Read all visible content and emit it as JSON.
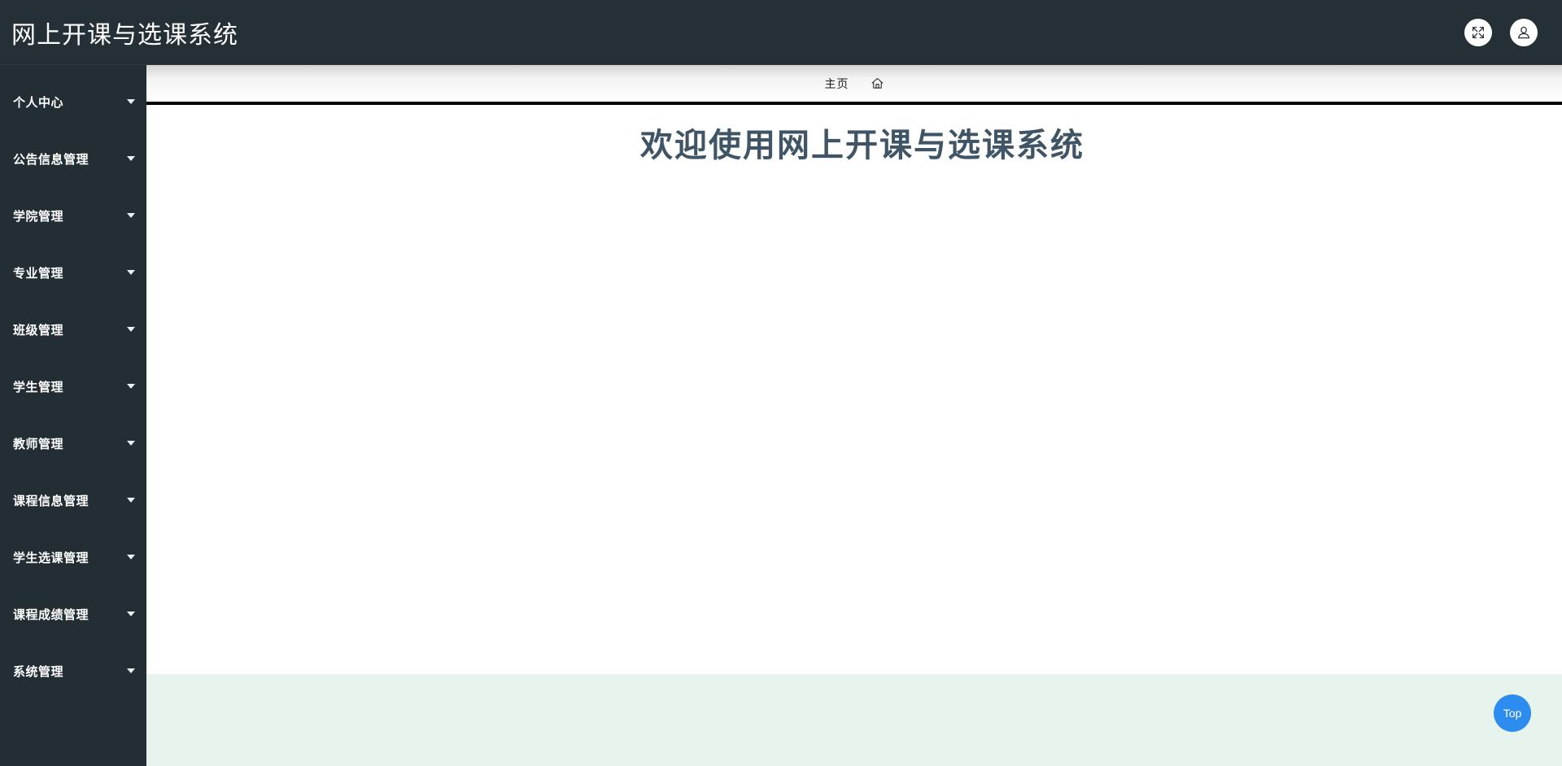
{
  "header": {
    "title": "网上开课与选课系统",
    "background_color": "#242f36",
    "actions": [
      {
        "name": "fullscreen-button",
        "icon": "fullscreen-arrows-icon"
      },
      {
        "name": "user-button",
        "icon": "user-icon"
      }
    ]
  },
  "sidebar": {
    "background_color": "#232d34",
    "items": [
      {
        "label": "个人中心",
        "icon": "chevron-down-icon"
      },
      {
        "label": "公告信息管理",
        "icon": "chevron-down-icon"
      },
      {
        "label": "学院管理",
        "icon": "chevron-down-icon"
      },
      {
        "label": "专业管理",
        "icon": "chevron-down-icon"
      },
      {
        "label": "班级管理",
        "icon": "chevron-down-icon"
      },
      {
        "label": "学生管理",
        "icon": "chevron-down-icon"
      },
      {
        "label": "教师管理",
        "icon": "chevron-down-icon"
      },
      {
        "label": "课程信息管理",
        "icon": "chevron-down-icon"
      },
      {
        "label": "学生选课管理",
        "icon": "chevron-down-icon"
      },
      {
        "label": "课程成绩管理",
        "icon": "chevron-down-icon"
      },
      {
        "label": "系统管理",
        "icon": "chevron-down-icon"
      }
    ]
  },
  "breadcrumb": {
    "home_label": "主页",
    "home_icon": "home-icon"
  },
  "main": {
    "welcome_title": "欢迎使用网上开课与选课系统",
    "title_color": "#3f5566"
  },
  "footer": {
    "background_color": "#e7f3ed"
  },
  "back_to_top": {
    "label": "Top",
    "color": "#2d8cf0"
  }
}
